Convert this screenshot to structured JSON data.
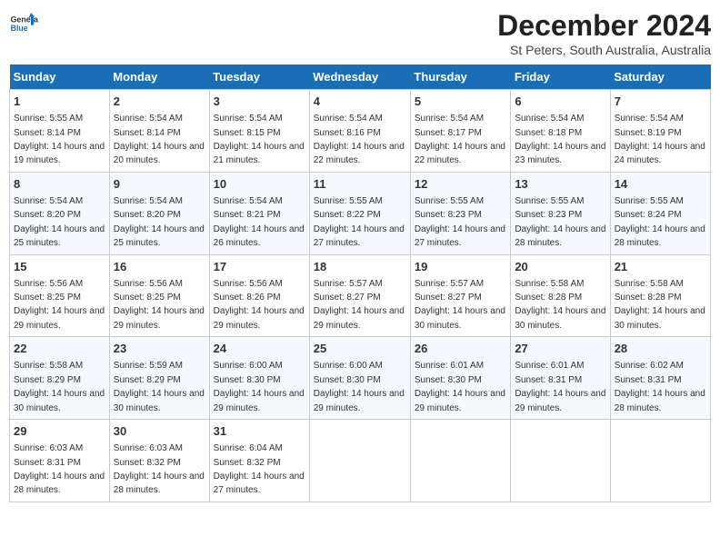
{
  "logo": {
    "line1": "General",
    "line2": "Blue"
  },
  "title": "December 2024",
  "subtitle": "St Peters, South Australia, Australia",
  "days_header": [
    "Sunday",
    "Monday",
    "Tuesday",
    "Wednesday",
    "Thursday",
    "Friday",
    "Saturday"
  ],
  "weeks": [
    [
      {
        "day": "1",
        "sunrise": "5:55 AM",
        "sunset": "8:14 PM",
        "daylight": "14 hours and 19 minutes."
      },
      {
        "day": "2",
        "sunrise": "5:54 AM",
        "sunset": "8:14 PM",
        "daylight": "14 hours and 20 minutes."
      },
      {
        "day": "3",
        "sunrise": "5:54 AM",
        "sunset": "8:15 PM",
        "daylight": "14 hours and 21 minutes."
      },
      {
        "day": "4",
        "sunrise": "5:54 AM",
        "sunset": "8:16 PM",
        "daylight": "14 hours and 22 minutes."
      },
      {
        "day": "5",
        "sunrise": "5:54 AM",
        "sunset": "8:17 PM",
        "daylight": "14 hours and 22 minutes."
      },
      {
        "day": "6",
        "sunrise": "5:54 AM",
        "sunset": "8:18 PM",
        "daylight": "14 hours and 23 minutes."
      },
      {
        "day": "7",
        "sunrise": "5:54 AM",
        "sunset": "8:19 PM",
        "daylight": "14 hours and 24 minutes."
      }
    ],
    [
      {
        "day": "8",
        "sunrise": "5:54 AM",
        "sunset": "8:20 PM",
        "daylight": "14 hours and 25 minutes."
      },
      {
        "day": "9",
        "sunrise": "5:54 AM",
        "sunset": "8:20 PM",
        "daylight": "14 hours and 25 minutes."
      },
      {
        "day": "10",
        "sunrise": "5:54 AM",
        "sunset": "8:21 PM",
        "daylight": "14 hours and 26 minutes."
      },
      {
        "day": "11",
        "sunrise": "5:55 AM",
        "sunset": "8:22 PM",
        "daylight": "14 hours and 27 minutes."
      },
      {
        "day": "12",
        "sunrise": "5:55 AM",
        "sunset": "8:23 PM",
        "daylight": "14 hours and 27 minutes."
      },
      {
        "day": "13",
        "sunrise": "5:55 AM",
        "sunset": "8:23 PM",
        "daylight": "14 hours and 28 minutes."
      },
      {
        "day": "14",
        "sunrise": "5:55 AM",
        "sunset": "8:24 PM",
        "daylight": "14 hours and 28 minutes."
      }
    ],
    [
      {
        "day": "15",
        "sunrise": "5:56 AM",
        "sunset": "8:25 PM",
        "daylight": "14 hours and 29 minutes."
      },
      {
        "day": "16",
        "sunrise": "5:56 AM",
        "sunset": "8:25 PM",
        "daylight": "14 hours and 29 minutes."
      },
      {
        "day": "17",
        "sunrise": "5:56 AM",
        "sunset": "8:26 PM",
        "daylight": "14 hours and 29 minutes."
      },
      {
        "day": "18",
        "sunrise": "5:57 AM",
        "sunset": "8:27 PM",
        "daylight": "14 hours and 29 minutes."
      },
      {
        "day": "19",
        "sunrise": "5:57 AM",
        "sunset": "8:27 PM",
        "daylight": "14 hours and 30 minutes."
      },
      {
        "day": "20",
        "sunrise": "5:58 AM",
        "sunset": "8:28 PM",
        "daylight": "14 hours and 30 minutes."
      },
      {
        "day": "21",
        "sunrise": "5:58 AM",
        "sunset": "8:28 PM",
        "daylight": "14 hours and 30 minutes."
      }
    ],
    [
      {
        "day": "22",
        "sunrise": "5:58 AM",
        "sunset": "8:29 PM",
        "daylight": "14 hours and 30 minutes."
      },
      {
        "day": "23",
        "sunrise": "5:59 AM",
        "sunset": "8:29 PM",
        "daylight": "14 hours and 30 minutes."
      },
      {
        "day": "24",
        "sunrise": "6:00 AM",
        "sunset": "8:30 PM",
        "daylight": "14 hours and 29 minutes."
      },
      {
        "day": "25",
        "sunrise": "6:00 AM",
        "sunset": "8:30 PM",
        "daylight": "14 hours and 29 minutes."
      },
      {
        "day": "26",
        "sunrise": "6:01 AM",
        "sunset": "8:30 PM",
        "daylight": "14 hours and 29 minutes."
      },
      {
        "day": "27",
        "sunrise": "6:01 AM",
        "sunset": "8:31 PM",
        "daylight": "14 hours and 29 minutes."
      },
      {
        "day": "28",
        "sunrise": "6:02 AM",
        "sunset": "8:31 PM",
        "daylight": "14 hours and 28 minutes."
      }
    ],
    [
      {
        "day": "29",
        "sunrise": "6:03 AM",
        "sunset": "8:31 PM",
        "daylight": "14 hours and 28 minutes."
      },
      {
        "day": "30",
        "sunrise": "6:03 AM",
        "sunset": "8:32 PM",
        "daylight": "14 hours and 28 minutes."
      },
      {
        "day": "31",
        "sunrise": "6:04 AM",
        "sunset": "8:32 PM",
        "daylight": "14 hours and 27 minutes."
      },
      null,
      null,
      null,
      null
    ]
  ]
}
